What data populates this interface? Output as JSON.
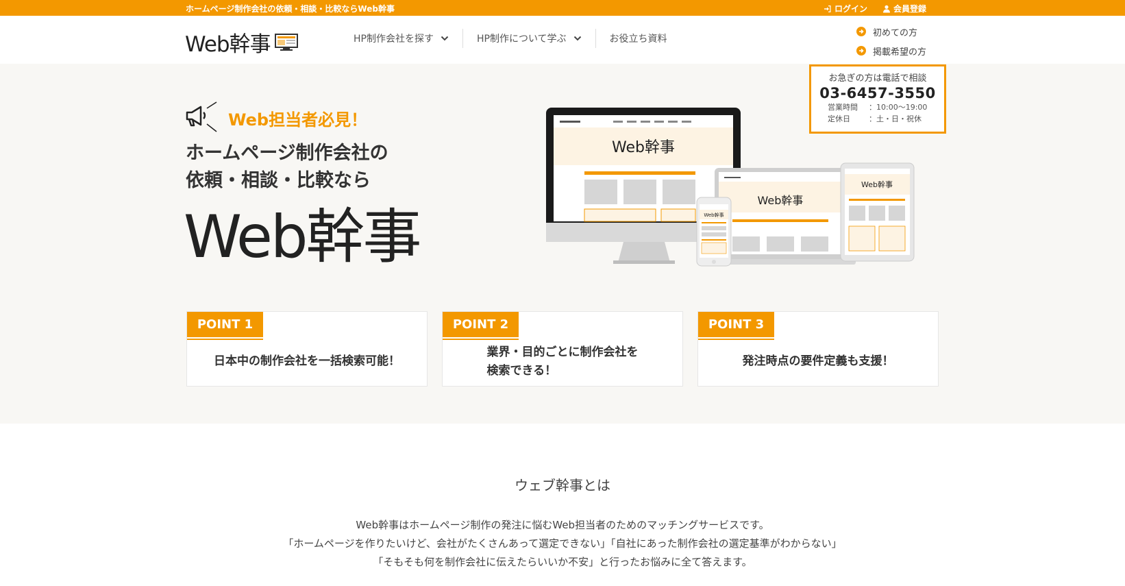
{
  "topbar": {
    "tagline": "ホームページ制作会社の依頼・相談・比較ならWeb幹事",
    "login": "ログイン",
    "register": "会員登録"
  },
  "header": {
    "logo": "Web幹事",
    "nav": [
      {
        "label": "HP制作会社を探す"
      },
      {
        "label": "HP制作について学ぶ"
      },
      {
        "label": "お役立ち資料"
      }
    ],
    "links": [
      {
        "label": "初めての方"
      },
      {
        "label": "掲載希望の方"
      }
    ]
  },
  "phone_box": {
    "title": "お急ぎの方は電話で相談",
    "number": "03-6457-3550",
    "hours_key": "営業時間",
    "hours_value": "：10:00〜19:00",
    "closed_key": "定休日",
    "closed_value": "：土・日・祝休"
  },
  "hero": {
    "catch": "Web担当者必見！",
    "title_line1": "ホームページ制作会社の",
    "title_line2": "依頼・相談・比較なら",
    "logo": "Web幹事",
    "device_logo": "Web幹事"
  },
  "points": [
    {
      "badge": "POINT 1",
      "line1": "日本中の制作会社を一括検索可能！",
      "line2": ""
    },
    {
      "badge": "POINT 2",
      "line1": "業界・目的ごとに制作会社を",
      "line2": "検索できる！"
    },
    {
      "badge": "POINT 3",
      "line1": "発注時点の要件定義も支援！",
      "line2": ""
    }
  ],
  "about": {
    "title": "ウェブ幹事とは",
    "line1": "Web幹事はホームページ制作の発注に悩むWeb担当者のためのマッチングサービスです。",
    "line2": "「ホームページを作りたいけど、会社がたくさんあって選定できない」「自社にあった制作会社の選定基準がわからない」",
    "line3": "「そもそも何を制作会社に伝えたらいいか不安」と行ったお悩みに全て答えます。"
  },
  "colors": {
    "accent": "#f39800",
    "hero_bg": "#f8f7f4"
  }
}
